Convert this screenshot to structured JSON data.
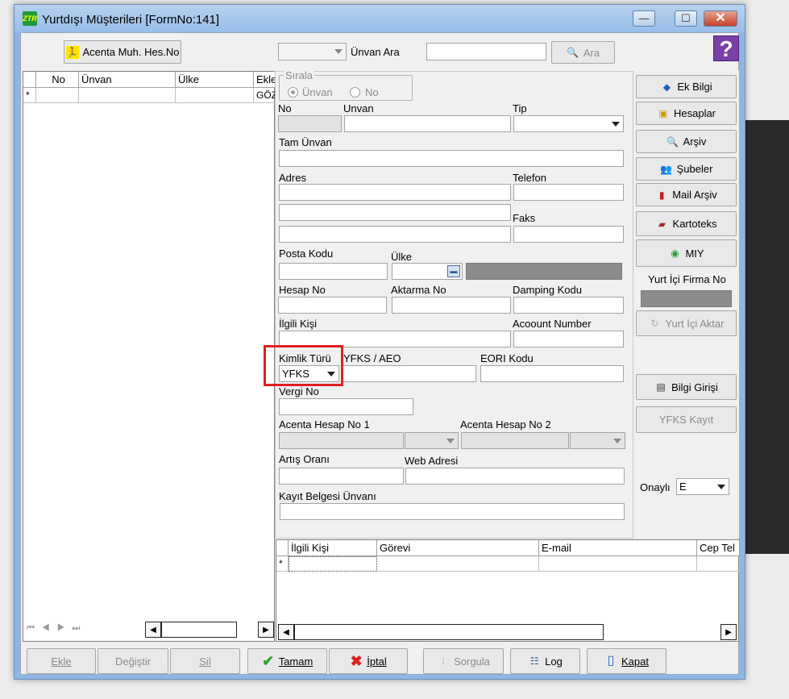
{
  "window": {
    "title": "Yurtdışı Müşterileri [FormNo:141]",
    "icon_text": "ZTR",
    "min": "—",
    "max": "☐",
    "close": "✕"
  },
  "toolbar": {
    "acenta_btn": "Acenta Muh. Hes.No",
    "unvan_ara_label": "Ünvan Ara",
    "search_value": "",
    "ara_btn": "Ara",
    "help": "?"
  },
  "left_grid": {
    "headers": [
      "No",
      "Ünvan",
      "Ülke",
      "Ekle"
    ],
    "new_row_marker": "*",
    "new_row_cells": [
      "",
      "",
      "",
      "GÖZ"
    ]
  },
  "form": {
    "sirala_legend": "Sırala",
    "sirala_options": [
      "Ünvan",
      "No"
    ],
    "no_label": "No",
    "unvan_label": "Unvan",
    "tip_label": "Tip",
    "tam_unvan_label": "Tam Ünvan",
    "adres_label": "Adres",
    "telefon_label": "Telefon",
    "faks_label": "Faks",
    "posta_kodu_label": "Posta Kodu",
    "ulke_label": "Ülke",
    "hesap_no_label": "Hesap No",
    "aktarma_no_label": "Aktarma No",
    "damping_kodu_label": "Damping Kodu",
    "ilgili_kisi_label": "İlgili Kişi",
    "account_number_label": "Acoount Number",
    "kimlik_turu_label": "Kimlik Türü",
    "kimlik_turu_value": "YFKS",
    "yfks_aeo_label": "YFKS / AEO",
    "eori_kodu_label": "EORI Kodu",
    "vergi_no_label": "Vergi No",
    "acenta_hesap_1_label": "Acenta Hesap No 1",
    "acenta_hesap_2_label": "Acenta Hesap No 2",
    "artis_orani_label": "Artış Oranı",
    "web_adresi_label": "Web Adresi",
    "kayit_belgesi_label": "Kayıt Belgesi Ünvanı"
  },
  "right_panel": {
    "ek_bilgi": "Ek Bilgi",
    "hesaplar": "Hesaplar",
    "arsiv": "Arşiv",
    "subeler": "Şubeler",
    "mail_arsiv": "Mail Arşiv",
    "kartoteks": "Kartoteks",
    "miy": "MIY",
    "yurt_ici_firma_no_label": "Yurt İçi Firma No",
    "yurt_ici_aktar": "Yurt İçi Aktar",
    "bilgi_girisi": "Bilgi Girişi",
    "yfks_kayit": "YFKS Kayıt",
    "onayli_label": "Onaylı",
    "onayli_value": "E"
  },
  "contact_grid": {
    "headers": [
      "İlgili Kişi",
      "Görevi",
      "E-mail",
      "Cep Tel"
    ],
    "new_row_marker": "*"
  },
  "bottom": {
    "ekle": "Ekle",
    "degistir": "Değiştir",
    "sil": "Sil",
    "tamam": "Tamam",
    "iptal": "İptal",
    "sorgula": "Sorgula",
    "log": "Log",
    "kapat": "Kapat"
  },
  "nav": {
    "first": "⏮",
    "prev": "◀",
    "next": "▶",
    "last": "⏭"
  },
  "colors": {
    "highlight": "#e02020",
    "help_bg": "#7b3fa8",
    "tamam_check": "#2aa52a",
    "iptal_x": "#e02020"
  }
}
